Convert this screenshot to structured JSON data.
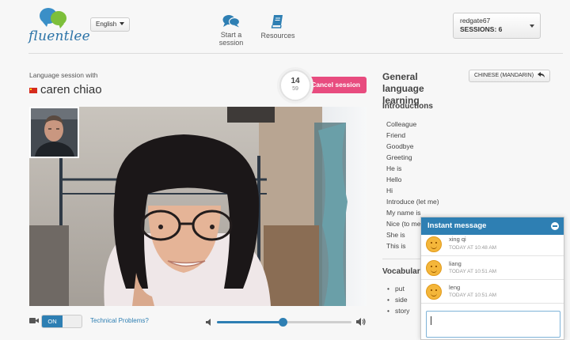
{
  "header": {
    "logo_text": "fluentlee",
    "language_selector": "English",
    "nav": [
      {
        "label": "Start a session",
        "icon": "chat-bubbles-icon"
      },
      {
        "label": "Resources",
        "icon": "book-icon"
      }
    ],
    "user": {
      "username": "redgate67",
      "sessions_label": "SESSIONS: 6"
    }
  },
  "session": {
    "with_label": "Language session with",
    "partner_name": "caren chiao",
    "partner_flag": "china-flag-icon",
    "timer": {
      "minutes": "14",
      "seconds": "59"
    },
    "cancel_label": "Cancel session"
  },
  "controls": {
    "camera_toggle": "ON",
    "technical_link": "Technical Problems?",
    "volume_level": 0.49
  },
  "lesson": {
    "title": "General language learning",
    "language_button": "CHINESE (MANDARIN)",
    "introductions_heading": "Introductions",
    "introductions": [
      "Colleague",
      "Friend",
      "Goodbye",
      "Greeting",
      "He is",
      "Hello",
      "Hi",
      "Introduce (let me)",
      "My name is",
      "Nice (to me",
      "She is",
      "This is"
    ],
    "vocabulary_heading": "Vocabulary",
    "vocabulary": [
      "put",
      "side",
      "story"
    ]
  },
  "instant_message": {
    "title": "Instant message",
    "messages": [
      {
        "name": "xing qi",
        "time": "TODAY AT 10:48 AM"
      },
      {
        "name": "liang",
        "time": "TODAY AT 10:51 AM"
      },
      {
        "name": "leng",
        "time": "TODAY AT 10:51 AM"
      }
    ],
    "input_value": ""
  },
  "colors": {
    "brand_blue": "#2e7fb3",
    "cancel_pink": "#e84c7f",
    "brand_green": "#7dbf3a"
  }
}
